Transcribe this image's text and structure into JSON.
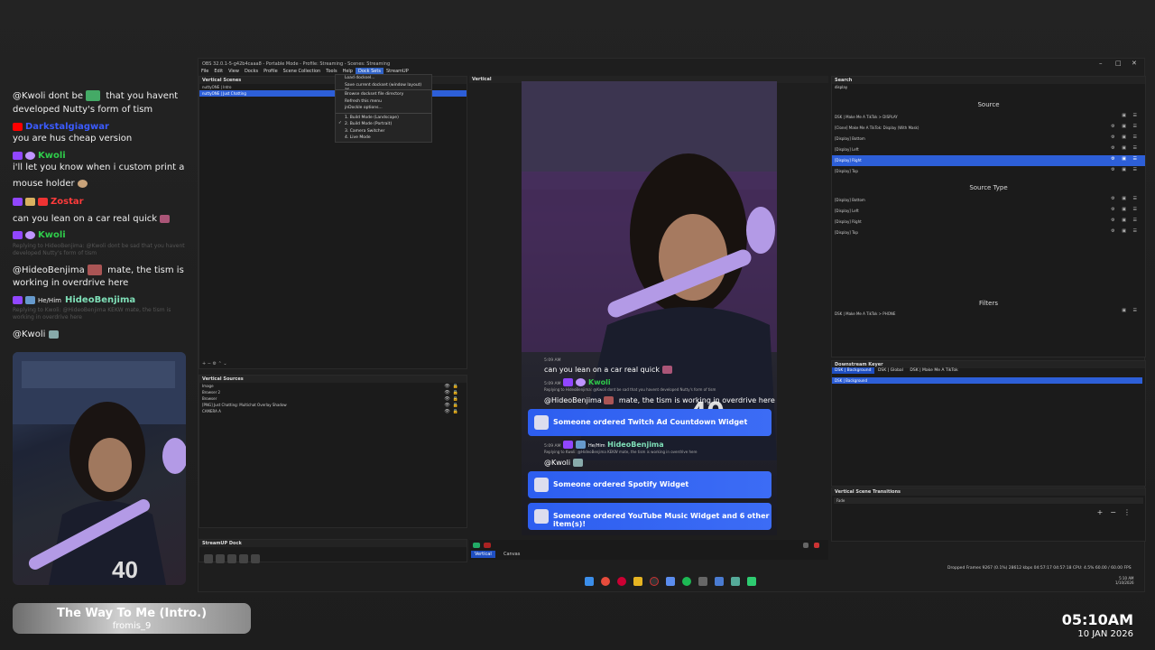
{
  "chat": {
    "msg1_prefix": "@Kwoli dont be",
    "msg1_suffix": "that you havent",
    "msg1_line2": "developed Nutty's form of tism",
    "user2": "Darkstalgiagwar",
    "msg2": "you are hus cheap version",
    "user3": "Kwoli",
    "msg3_line1": "i'll let you know when i custom print a",
    "msg3_line2": "mouse holder",
    "user4": "Zostar",
    "msg4": "can you lean on a car real quick",
    "user5": "Kwoli",
    "reply5": "Replying to HideoBenjima: @Kwoli dont be sad that you havent developed Nutty's form of tism",
    "msg5_prefix": "@HideoBenjima",
    "msg5_suffix": "mate, the tism is",
    "msg5_line2": "working in overdrive here",
    "pronoun6": "He/Him",
    "user6": "HideoBenjima",
    "reply6": "Replying to Kwoli: @HideoBenjima KEKW mate, the tism is working in overdrive here",
    "msg6": "@Kwoli"
  },
  "song": {
    "title": "The Way To Me (Intro.)",
    "artist": "fromis_9"
  },
  "clock": {
    "time": "05:10AM",
    "date": "10 JAN 2026"
  },
  "obs": {
    "title": "OBS 32.0.1-5-g42b4caaa8 - Portable Mode - Profile: Streaming - Scenes: Streaming",
    "menu": [
      "File",
      "Edit",
      "View",
      "Docks",
      "Profile",
      "Scene Collection",
      "Tools",
      "Help",
      "Dock Sets",
      "StreamUP"
    ],
    "menu_active": "Dock Sets",
    "dock_menu": [
      "Load docksel...",
      "Save current dockset (window layout) as...",
      "Browse dockset file directory",
      "Refresh this menu",
      "jnDockle options...",
      "1. Build Mode (Landscape)",
      "2. Build Mode (Portrait)",
      "3. Camera Switcher",
      "4. Live Mode"
    ],
    "scenes_title": "Vertical Scenes",
    "scenes": [
      "nuttyONE | Intro",
      "nuttyONE | Just Chatting"
    ],
    "sources_title": "Vertical Sources",
    "sources": [
      "Image",
      "Browser 2",
      "Browser",
      "[PNG] Just Chatting: Multichat Overlay Shadow",
      "CAMERA A"
    ],
    "streamup_title": "StreamUP Dock",
    "preview_title": "Vertical",
    "tabs": [
      "Vertical",
      "Canvas"
    ],
    "search_title": "Search",
    "search_value": "display",
    "source_label": "Source",
    "source_items": [
      "DSK | Make Me A TikTok > DISPLAY",
      "[Clone] Make Me A TikTok: Display (With Mask)",
      "[Display] Bottom",
      "[Display] Left",
      "[Display] Right",
      "[Display] Top"
    ],
    "source_type_label": "Source Type",
    "type_items": [
      "[Display] Bottom",
      "[Display] Left",
      "[Display] Right",
      "[Display] Top"
    ],
    "filters_label": "Filters",
    "filter_items": [
      "DSK | Make Me A TikTok > PHONE"
    ],
    "dsk_title": "Downstream Keyer",
    "dsk_tabs": [
      "DSK | Background",
      "DSK | Global",
      "DSK | Make Me A TikTok"
    ],
    "dsk_item": "DSK | Background",
    "trans_title": "Vertical Scene Transitions",
    "trans_value": "Fade",
    "status": "Dropped Frames 9267 (0.1%)   28612 kbps   04:57:17   04:57:18  CPU: 4.5%  60.00 / 60.00 FPS",
    "win_clock_time": "5:10 AM",
    "win_clock_date": "1/10/2026"
  },
  "preview": {
    "time1": "5:09 AM",
    "line1": "can you lean on a car real quick",
    "time2": "5:09 AM",
    "user2": "Kwoli",
    "reply2": "Replying to HideoBenjima: @Kwoli dont be sad that you havent developed Nutty's form of tism",
    "msg2_prefix": "@HideoBenjima",
    "msg2_suffix": "mate, the tism is working in overdrive here",
    "order1": "Someone ordered Twitch Ad Countdown Widget",
    "time3": "5:09 AM",
    "pronoun3": "He/Him",
    "user3": "HideoBenjima",
    "reply3": "Replying to Kwoli: @HideoBenjima KEKW mate, the tism is working in overdrive here",
    "msg3": "@Kwoli",
    "order2": "Someone ordered Spotify Widget",
    "order3": "Someone ordered YouTube Music Widget and 6 other item(s)!"
  },
  "colors": {
    "accent": "#2d5fd8",
    "kwoli": "#2fcc4a",
    "darkstalgia": "#3b5bff",
    "zostar": "#ff3b3b",
    "hideo": "#7fe0b8"
  }
}
